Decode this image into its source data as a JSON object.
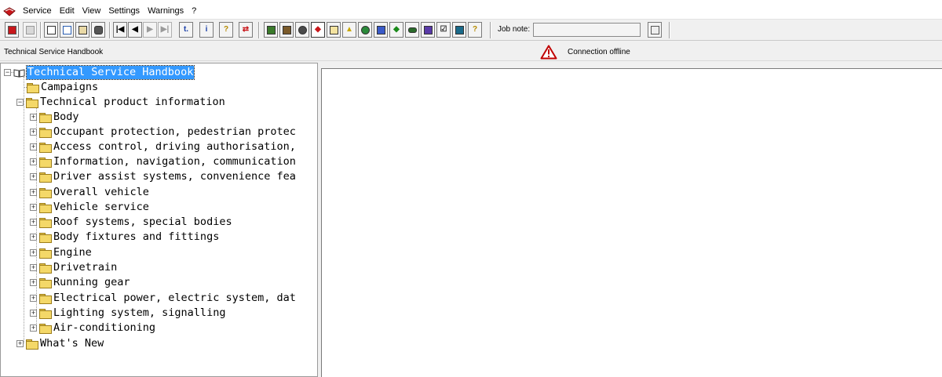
{
  "menu": {
    "items": [
      "Service",
      "Edit",
      "View",
      "Settings",
      "Warnings",
      "?"
    ]
  },
  "toolbar": {
    "job_note_label": "Job note:",
    "job_note_value": "",
    "buttons": [
      "exit-icon",
      "print-icon",
      "new-document-icon",
      "edit-document-icon",
      "clipboard-icon",
      "vehicle-icon",
      "first-icon",
      "previous-icon",
      "next-icon",
      "last-icon",
      "jump-icon",
      "info-icon",
      "help-icon",
      "swap-icon",
      "handbook-icon",
      "tool-icon",
      "person-icon",
      "diamond-icon",
      "list-icon",
      "warning-icon",
      "globe-icon",
      "save-icon",
      "leaf-icon",
      "car-icon",
      "transfer-icon",
      "checkbox-icon",
      "wrench-icon",
      "help-page-icon",
      "job-note-settings-icon"
    ]
  },
  "infobar": {
    "title": "Technical Service Handbook",
    "connection_status": "Connection offline"
  },
  "tree": {
    "root": "Technical Service Handbook",
    "campaigns": "Campaigns",
    "technical_product_information": "Technical product information",
    "children": [
      "Body",
      "Occupant protection, pedestrian protec",
      "Access control, driving authorisation,",
      "Information, navigation, communication",
      "Driver assist systems, convenience fea",
      "Overall vehicle",
      "Vehicle service",
      "Roof systems, special bodies",
      "Body fixtures and fittings",
      "Engine",
      "Drivetrain",
      "Running gear",
      "Electrical power, electric system, dat",
      "Lighting system, signalling",
      "Air-conditioning"
    ],
    "whats_new": "What's New"
  },
  "colors": {
    "selection": "#3399ff",
    "warning": "#c00000",
    "folder": "#f4d868"
  }
}
